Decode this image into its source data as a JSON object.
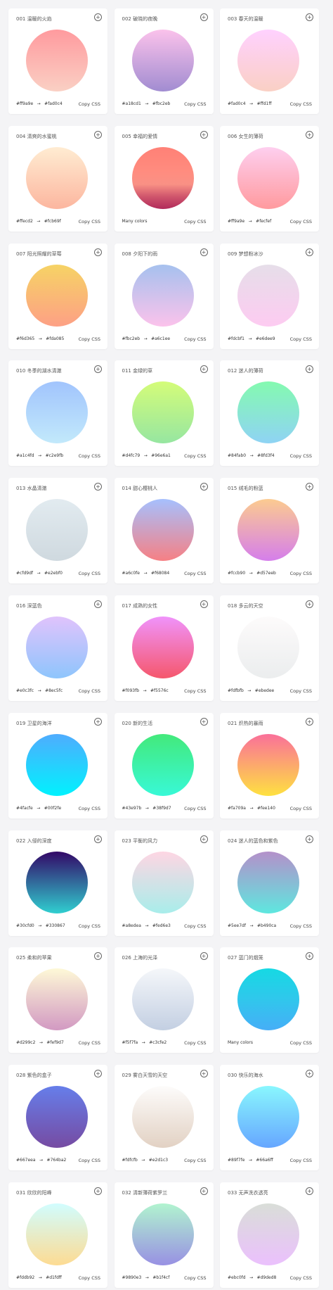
{
  "cards": [
    {
      "title": "001 温暖的火焰",
      "from": "#ff9a9e",
      "to": "#fad0c4",
      "colors": [
        "#ff9a9e",
        "#fad0c4"
      ],
      "copy": "Copy CSS"
    },
    {
      "title": "002 破晓的夜晚",
      "from": "#a18cd1",
      "to": "#fbc2eb",
      "colors": [
        "#fbc2eb",
        "#a18cd1"
      ],
      "copy": "Copy CSS"
    },
    {
      "title": "003 春天的温暖",
      "from": "#fad0c4",
      "to": "#ffd1ff",
      "colors": [
        "#ffd1ff",
        "#fad0c4"
      ],
      "copy": "Copy CSS"
    },
    {
      "title": "004 清爽的水蜜桃",
      "from": "#ffecd2",
      "to": "#fcb69f",
      "colors": [
        "#ffecd2",
        "#fcb69f"
      ],
      "copy": "Copy CSS"
    },
    {
      "title": "005 幸福的爱情",
      "label": "Many colors",
      "colors": [
        "#ff8177",
        "#ff867a",
        "#ff8c7f",
        "#f99185",
        "#cf556c",
        "#b12a5b"
      ],
      "copy": "Copy CSS"
    },
    {
      "title": "006 女生的薄荷",
      "from": "#ff9a9e",
      "to": "#fecfef",
      "colors": [
        "#fecfef",
        "#ff9a9e"
      ],
      "copy": "Copy CSS"
    },
    {
      "title": "007 阳光照耀的草莓",
      "from": "#f6d365",
      "to": "#fda085",
      "colors": [
        "#f6d365",
        "#fda085"
      ],
      "copy": "Copy CSS"
    },
    {
      "title": "008 夕阳下的雨",
      "from": "#fbc2eb",
      "to": "#a6c1ee",
      "colors": [
        "#a6c1ee",
        "#fbc2eb"
      ],
      "copy": "Copy CSS"
    },
    {
      "title": "009 梦想粉冰沙",
      "from": "#fdcbf1",
      "to": "#e6dee9",
      "colors": [
        "#e6dee9",
        "#fdcbf1"
      ],
      "copy": "Copy CSS"
    },
    {
      "title": "010 冬季的湖水清澈",
      "from": "#a1c4fd",
      "to": "#c2e9fb",
      "colors": [
        "#a1c4fd",
        "#c2e9fb"
      ],
      "copy": "Copy CSS"
    },
    {
      "title": "011 金绿的草",
      "from": "#d4fc79",
      "to": "#96e6a1",
      "colors": [
        "#d4fc79",
        "#96e6a1"
      ],
      "copy": "Copy CSS"
    },
    {
      "title": "012 迷人的薄荷",
      "from": "#84fab0",
      "to": "#8fd3f4",
      "colors": [
        "#84fab0",
        "#8fd3f4"
      ],
      "copy": "Copy CSS"
    },
    {
      "title": "013 水晶清澈",
      "from": "#cfd9df",
      "to": "#e2ebf0",
      "colors": [
        "#e2ebf0",
        "#cfd9df"
      ],
      "copy": "Copy CSS"
    },
    {
      "title": "014 甜心樱桃人",
      "from": "#a6c0fe",
      "to": "#f68084",
      "colors": [
        "#a6c0fe",
        "#f68084"
      ],
      "copy": "Copy CSS"
    },
    {
      "title": "015 绒毛的粉蓝",
      "from": "#fccb90",
      "to": "#d57eeb",
      "colors": [
        "#fccb90",
        "#d57eeb"
      ],
      "copy": "Copy CSS"
    },
    {
      "title": "016 深蓝色",
      "from": "#e0c3fc",
      "to": "#8ec5fc",
      "colors": [
        "#e0c3fc",
        "#8ec5fc"
      ],
      "copy": "Copy CSS"
    },
    {
      "title": "017 成熟的女性",
      "from": "#f093fb",
      "to": "#f5576c",
      "colors": [
        "#f093fb",
        "#f5576c"
      ],
      "copy": "Copy CSS"
    },
    {
      "title": "018 多云的天空",
      "from": "#fdfbfb",
      "to": "#ebedee",
      "colors": [
        "#fdfbfb",
        "#ebedee"
      ],
      "copy": "Copy CSS"
    },
    {
      "title": "019 卫星的海洋",
      "from": "#4facfe",
      "to": "#00f2fe",
      "colors": [
        "#4facfe",
        "#00f2fe"
      ],
      "copy": "Copy CSS"
    },
    {
      "title": "020 新的生活",
      "from": "#43e97b",
      "to": "#38f9d7",
      "colors": [
        "#43e97b",
        "#38f9d7"
      ],
      "copy": "Copy CSS"
    },
    {
      "title": "021 炽热的暴雨",
      "from": "#fa709a",
      "to": "#fee140",
      "colors": [
        "#fa709a",
        "#fee140"
      ],
      "copy": "Copy CSS"
    },
    {
      "title": "022 入侵的深度",
      "from": "#30cfd0",
      "to": "#330867",
      "colors": [
        "#330867",
        "#30cfd0"
      ],
      "copy": "Copy CSS"
    },
    {
      "title": "023 平衡的风力",
      "from": "#a8edea",
      "to": "#fed6e3",
      "colors": [
        "#fed6e3",
        "#a8edea"
      ],
      "copy": "Copy CSS"
    },
    {
      "title": "024 迷人的蓝色和紫色",
      "from": "#5ee7df",
      "to": "#b490ca",
      "colors": [
        "#b490ca",
        "#5ee7df"
      ],
      "copy": "Copy CSS"
    },
    {
      "title": "025 柔和的苹果",
      "from": "#d299c2",
      "to": "#fef9d7",
      "colors": [
        "#fef9d7",
        "#d299c2"
      ],
      "copy": "Copy CSS"
    },
    {
      "title": "026 上海的光泽",
      "from": "#f5f7fa",
      "to": "#c3cfe2",
      "colors": [
        "#f5f7fa",
        "#c3cfe2"
      ],
      "copy": "Copy CSS"
    },
    {
      "title": "027 蓝门的烟笼",
      "label": "Many colors",
      "colors": [
        "#16d9e3",
        "#30c7ec",
        "#46aef7"
      ],
      "copy": "Copy CSS"
    },
    {
      "title": "028 紫色的盒子",
      "from": "#667eea",
      "to": "#764ba2",
      "colors": [
        "#667eea",
        "#764ba2"
      ],
      "copy": "Copy CSS"
    },
    {
      "title": "029 雾白天雪的天空",
      "from": "#fdfcfb",
      "to": "#e2d1c3",
      "colors": [
        "#fdfcfb",
        "#e2d1c3"
      ],
      "copy": "Copy CSS"
    },
    {
      "title": "030 快乐的海水",
      "from": "#89f7fe",
      "to": "#66a6ff",
      "colors": [
        "#89f7fe",
        "#66a6ff"
      ],
      "copy": "Copy CSS"
    },
    {
      "title": "031 欣欣的阳峰",
      "from": "#fddb92",
      "to": "#d1fdff",
      "colors": [
        "#d1fdff",
        "#fddb92"
      ],
      "copy": "Copy CSS"
    },
    {
      "title": "032 清新薄荷紫罗兰",
      "from": "#9890e3",
      "to": "#b1f4cf",
      "colors": [
        "#b1f4cf",
        "#9890e3"
      ],
      "copy": "Copy CSS"
    },
    {
      "title": "033 无声洗衣透亮",
      "from": "#ebc0fd",
      "to": "#d9ded8",
      "colors": [
        "#d9ded8",
        "#ebc0fd"
      ],
      "copy": "Copy CSS"
    }
  ]
}
